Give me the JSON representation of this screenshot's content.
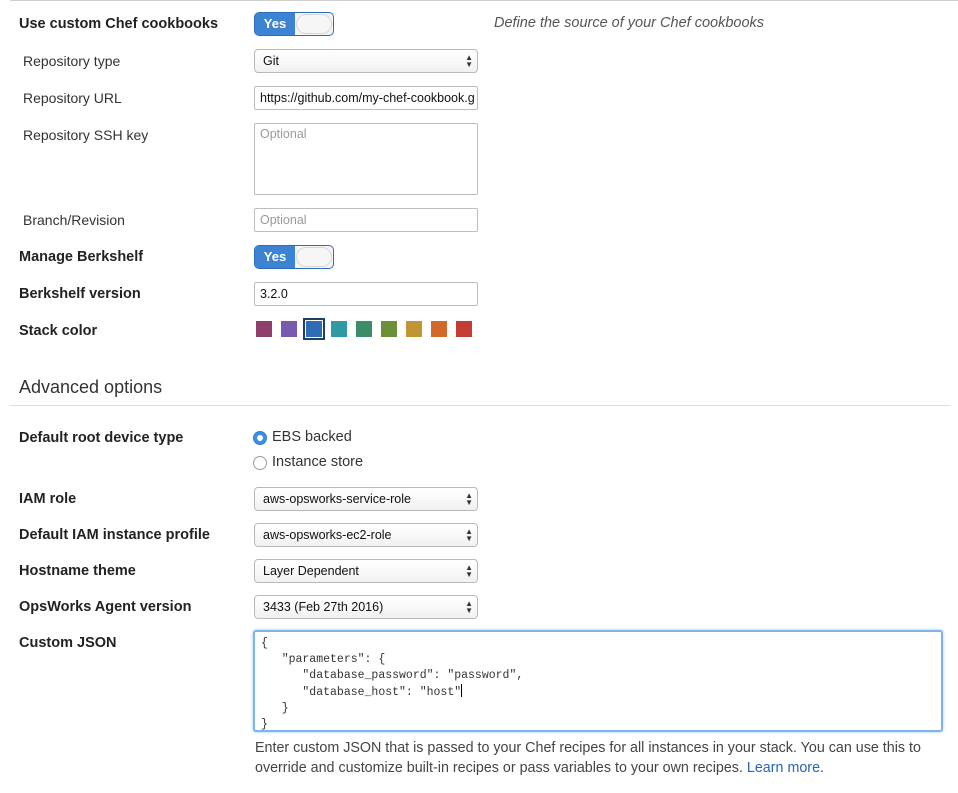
{
  "cookbooks": {
    "label": "Use custom Chef cookbooks",
    "toggle_label": "Yes",
    "hint": "Define the source of your Chef cookbooks"
  },
  "repository_type": {
    "label": "Repository type",
    "value": "Git"
  },
  "repository_url": {
    "label": "Repository URL",
    "value": "https://github.com/my-chef-cookbook.g"
  },
  "repository_ssh_key": {
    "label": "Repository SSH key",
    "placeholder": "Optional"
  },
  "branch_revision": {
    "label": "Branch/Revision",
    "placeholder": "Optional"
  },
  "manage_berkshelf": {
    "label": "Manage Berkshelf",
    "toggle_label": "Yes"
  },
  "berkshelf_version": {
    "label": "Berkshelf version",
    "value": "3.2.0"
  },
  "stack_color": {
    "label": "Stack color",
    "colors": [
      "#8e3f6e",
      "#7a5aae",
      "#2e6db6",
      "#2e9aa6",
      "#3c8c6a",
      "#6d8f3a",
      "#c09534",
      "#d2692a",
      "#c43d33"
    ],
    "selected_index": 2
  },
  "advanced": {
    "title": "Advanced options"
  },
  "root_device": {
    "label": "Default root device type",
    "options": [
      "EBS backed",
      "Instance store"
    ],
    "selected": "EBS backed"
  },
  "iam_role": {
    "label": "IAM role",
    "value": "aws-opsworks-service-role"
  },
  "instance_profile": {
    "label": "Default IAM instance profile",
    "value": "aws-opsworks-ec2-role"
  },
  "hostname_theme": {
    "label": "Hostname theme",
    "value": "Layer Dependent"
  },
  "agent_version": {
    "label": "OpsWorks Agent version",
    "value": "3433 (Feb 27th 2016)"
  },
  "custom_json": {
    "label": "Custom JSON",
    "lines": [
      "{",
      "   \"parameters\": {",
      "      \"database_password\": \"password\",",
      "      \"database_host\": \"host\"",
      "   }",
      "}"
    ],
    "help_text": "Enter custom JSON that is passed to your Chef recipes for all instances in your stack. You can use this to override and customize built-in recipes or pass variables to your own recipes.",
    "learn_more": "Learn more",
    "help_end": "."
  }
}
